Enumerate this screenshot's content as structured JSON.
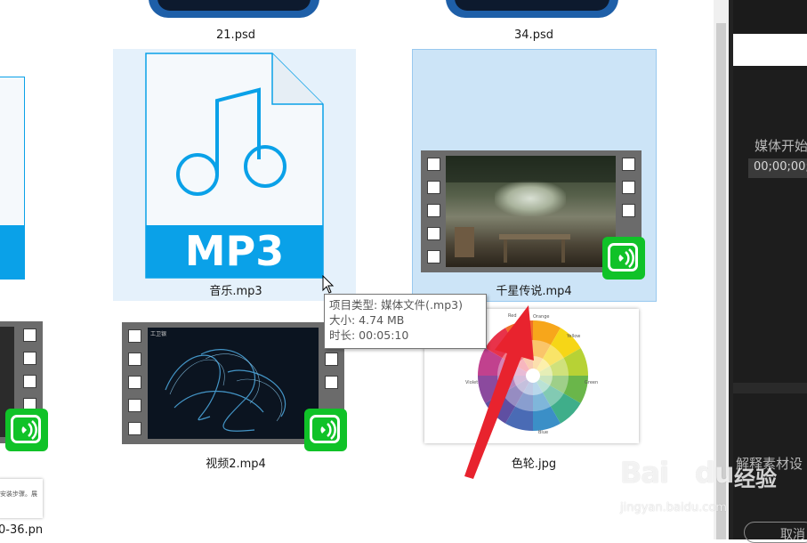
{
  "files": [
    {
      "name": "21.psd"
    },
    {
      "name": "34.psd"
    },
    {
      "name": "音乐.mp3",
      "icon_text": "MP3"
    },
    {
      "name": "千星传说.mp4"
    },
    {
      "name": "视频2.mp4",
      "thumb_caption": "工卫银"
    },
    {
      "name": "色轮.jpg"
    },
    {
      "name": "0-36.pn"
    }
  ],
  "doc_snippet": "安装步骤。展",
  "tooltip": {
    "type_line": "项目类型: 媒体文件(.mp3)",
    "size_line": "大小: 4.74 MB",
    "duration_line": "时长: 00:05:10"
  },
  "right_panel": {
    "media_start_label": "媒体开始",
    "timecode": "00;00;00;",
    "interpret_label": "解释素材设",
    "cancel_button": "取消"
  },
  "watermark": {
    "brand": "Bai",
    "brand2": "du",
    "cn": "经验",
    "url": "jingyan.baidu.com"
  },
  "color_wheel_labels": [
    "Red",
    "Orange",
    "Yellow",
    "Green",
    "Blue",
    "Violet"
  ],
  "colors": {
    "accent_blue": "#0aa1e8",
    "selection": "#cce4f7",
    "hover": "#e5f1fb",
    "badge_green": "#10c228",
    "arrow_red": "#e8232e",
    "panel_dark": "#232323"
  }
}
